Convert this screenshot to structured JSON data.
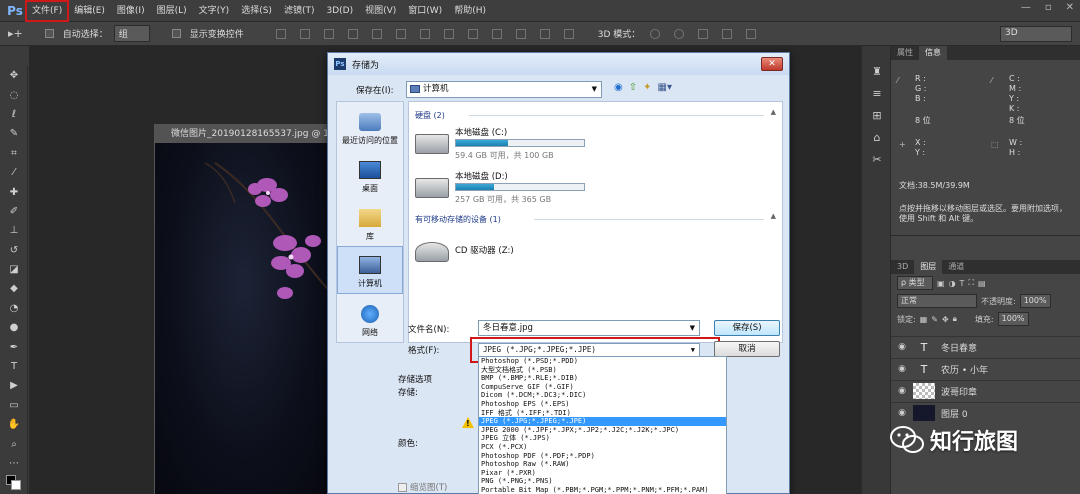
{
  "app": {
    "logo": "Ps",
    "menu": [
      "文件(F)",
      "编辑(E)",
      "图像(I)",
      "图层(L)",
      "文字(Y)",
      "选择(S)",
      "滤镜(T)",
      "3D(D)",
      "视图(V)",
      "窗口(W)",
      "帮助(H)"
    ],
    "win_controls": [
      "—",
      "▫",
      "✕"
    ]
  },
  "options_bar": {
    "auto_select_label": "自动选择：",
    "auto_select_value": "组",
    "show_transform_label": "显示变换控件",
    "mode_3d_label": "3D 模式：",
    "workspace_value": "3D"
  },
  "document": {
    "tab_title": "微信图片_20190128165537.jpg @ 16."
  },
  "dialog": {
    "title": "存储为",
    "close_glyph": "✕",
    "save_in_label": "保存在(I):",
    "save_in_value": "计算机",
    "places": [
      "最近访问的位置",
      "桌面",
      "库",
      "计算机",
      "网络"
    ],
    "groups": {
      "hard_disks": "硬盘 (2)",
      "removable": "有可移动存储的设备 (1)"
    },
    "drives": [
      {
        "name": "本地磁盘 (C:)",
        "info": "59.4 GB 可用，共 100 GB",
        "used_fraction": 0.41
      },
      {
        "name": "本地磁盘 (D:)",
        "info": "257 GB 可用，共 365 GB",
        "used_fraction": 0.3
      }
    ],
    "cd_drive": "CD 驱动器 (Z:)",
    "filename_label": "文件名(N):",
    "filename_value": "冬日春意.jpg",
    "format_label": "格式(F):",
    "format_value": "JPEG (*.JPG;*.JPEG;*.JPE)",
    "save_button": "保存(S)",
    "cancel_button": "取消",
    "save_options_label": "存储选项",
    "store_label": "存储:",
    "color_label": "颜色:",
    "thumbnail_label": "缩览图(T)",
    "format_options": [
      "Photoshop (*.PSD;*.PDD)",
      "大型文档格式 (*.PSB)",
      "BMP (*.BMP;*.RLE;*.DIB)",
      "CompuServe GIF (*.GIF)",
      "Dicom (*.DCM;*.DC3;*.DIC)",
      "Photoshop EPS (*.EPS)",
      "IFF 格式 (*.IFF;*.TDI)",
      "JPEG (*.JPG;*.JPEG;*.JPE)",
      "JPEG 2000 (*.JPF;*.JPX;*.JP2;*.J2C;*.J2K;*.JPC)",
      "JPEG 立体 (*.JPS)",
      "PCX (*.PCX)",
      "Photoshop PDF (*.PDF;*.PDP)",
      "Photoshop Raw (*.RAW)",
      "Pixar (*.PXR)",
      "PNG (*.PNG;*.PNS)",
      "Portable Bit Map (*.PBM;*.PGM;*.PPM;*.PNM;*.PFM;*.PAM)"
    ],
    "selected_format_index": 7
  },
  "info_panel": {
    "tabs": [
      "属性",
      "信息"
    ],
    "rgb": "R :\nG :\nB :",
    "cmyk": "C :\nM :\nY :\nK :",
    "bits_left": "8 位",
    "bits_right": "8 位",
    "xy": "X :\nY :",
    "wh": "W :\nH :",
    "doc_size": "文档:38.5M/39.9M",
    "help_text": "点按并拖移以移动图层或选区。要用附加选项，使用 Shift 和 Alt 键。"
  },
  "layers_panel": {
    "tabs": [
      "3D",
      "图层",
      "通道"
    ],
    "filter_label": "ρ 类型",
    "blend_mode": "正常",
    "opacity_label": "不透明度:",
    "opacity_value": "100%",
    "lock_label": "锁定:",
    "fill_label": "填充:",
    "fill_value": "100%",
    "layers": [
      {
        "name": "冬日春意",
        "kind": "T"
      },
      {
        "name": "农历 • 小年",
        "kind": "T"
      },
      {
        "name": "波哥印章",
        "kind": "img"
      },
      {
        "name": "图层 0",
        "kind": "photo"
      }
    ]
  },
  "watermark": {
    "text": "知行旅图"
  },
  "colors": {
    "accent_red": "#d01818",
    "selection_blue": "#3399ff",
    "drive_fill": "#1d7fb0"
  }
}
